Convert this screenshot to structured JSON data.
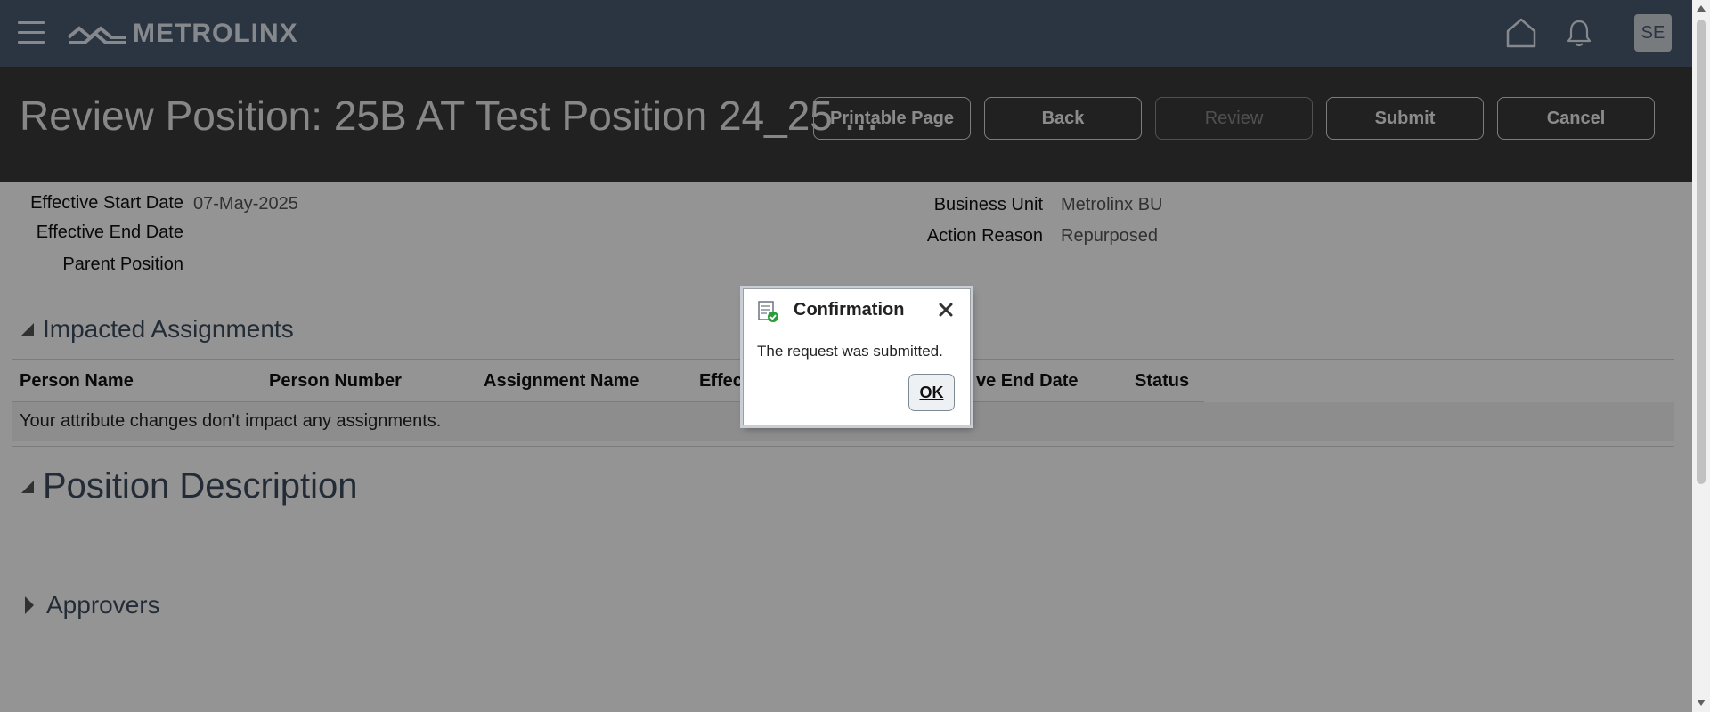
{
  "header": {
    "brand": "METROLINX",
    "avatar_initials": "SE",
    "icons": [
      "menu-icon",
      "home-icon",
      "bell-icon"
    ]
  },
  "titlebar": {
    "title": "Review Position: 25B AT Test Position 24_25 ...",
    "buttons": {
      "printable": "Printable Page",
      "back": "Back",
      "review": "Review",
      "submit": "Submit",
      "cancel": "Cancel"
    }
  },
  "details": {
    "effective_start_date_label": "Effective Start Date",
    "effective_start_date": "07-May-2025",
    "effective_end_date_label": "Effective End Date",
    "parent_position_label": "Parent Position",
    "business_unit_label": "Business Unit",
    "business_unit": "Metrolinx BU",
    "action_reason_label": "Action Reason",
    "action_reason": "Repurposed"
  },
  "impacted_assignments": {
    "heading": "Impacted Assignments",
    "columns": [
      "Person Name",
      "Person Number",
      "Assignment Name",
      "Effec",
      "ve End Date",
      "Status"
    ],
    "empty_message": "Your attribute changes don't impact any assignments."
  },
  "position_description": {
    "heading": "Position Description"
  },
  "approvers": {
    "heading": "Approvers"
  },
  "dialog": {
    "title": "Confirmation",
    "message": "The request was submitted.",
    "ok_label": "OK"
  },
  "colors": {
    "nav_bg": "#4a5b70",
    "titlebar_bg": "#3a3a3a",
    "success_green": "#2a9d3a"
  }
}
